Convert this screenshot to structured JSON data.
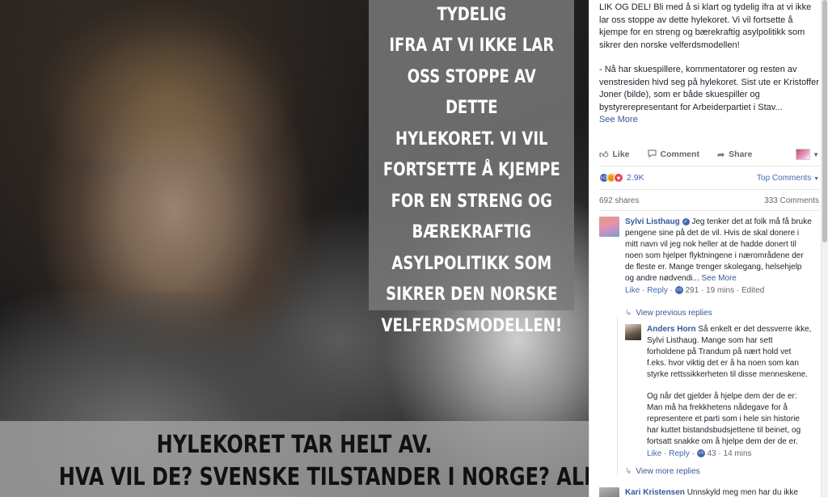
{
  "image": {
    "quote_lines": [
      "Å SI KLART OG TYDELIG",
      "IFRA AT VI IKKE LAR",
      "OSS STOPPE AV DETTE",
      "HYLEKORET. VI VIL",
      "FORTSETTE Å KJEMPE",
      "FOR EN STRENG OG",
      "BÆREKRAFTIG",
      "ASYLPOLITIKK SOM",
      "SIKRER DEN NORSKE",
      "VELFERDSMODELLEN!"
    ],
    "bottom_lines": [
      "HYLEKORET TAR HELT AV.",
      "HVA VIL DE? SVENSKE TILSTANDER I NORGE? ALLE SOM KOMMER"
    ]
  },
  "post": {
    "paragraph1": "LIK OG DEL! Bli med å si klart og tydelig ifra at vi ikke lar oss stoppe av dette hylekoret. Vi vil fortsette å kjempe for en streng og bærekraftig asylpolitikk som sikrer den norske velferdsmodellen!",
    "paragraph2": "- Nå har skuespillere, kommentatorer og resten av venstresiden hivd seg på hylekoret. Sist ute er Kristoffer Joner (bilde), som er både skuespiller og bystyrerepresentant for Arbeiderpartiet i Stav...",
    "see_more": "See More"
  },
  "actions": {
    "like": "Like",
    "comment": "Comment",
    "share": "Share"
  },
  "reactions": {
    "count": "2.9K",
    "sort": "Top Comments",
    "shares": "692 shares",
    "comments": "333 Comments"
  },
  "comments": [
    {
      "name": "Sylvi Listhaug",
      "text": "Jeg tenker det at folk må få bruke pengene sine på det de vil. Hvis de skal donere i mitt navn vil jeg nok heller at de hadde donert til noen som hjelper flyktningene i nærområdene der de fleste er. Mange trenger skolegang, helsehjelp og andre nødvendi...",
      "see_more": "See More",
      "like": "Like",
      "reply": "Reply",
      "likes": "291",
      "time": "19 mins",
      "edited": "Edited"
    }
  ],
  "view_previous": "View previous replies",
  "reply": {
    "name": "Anders Horn",
    "text1": "Så enkelt er det dessverre ikke, Sylvi Listhaug. Mange som har sett forholdene på Trandum på nært hold vet f.eks. hvor viktig det er å ha noen som kan styrke rettssikkerheten til disse menneskene.",
    "text2": "Og når det gjelder å hjelpe dem der de er: Man må ha frekkhetens nådegave for å representere et parti som i hele sin historie har kuttet bistandsbudsjettene til beinet, og fortsatt snakke om å hjelpe dem der de er.",
    "like": "Like",
    "reply": "Reply",
    "likes": "43",
    "time": "14 mins"
  },
  "view_more": "View more replies",
  "next_comment": {
    "name": "Kari Kristensen",
    "text": "Unnskyld meg men har du ikke"
  },
  "colors": {
    "facebook_blue": "#4267b2",
    "link_blue": "#365899",
    "meta_gray": "#606770"
  },
  "icons": [
    "thumbs-up-icon",
    "comment-icon",
    "share-icon",
    "like-reaction-icon",
    "haha-reaction-icon",
    "love-reaction-icon",
    "verified-badge-icon",
    "reply-arrow-icon"
  ]
}
